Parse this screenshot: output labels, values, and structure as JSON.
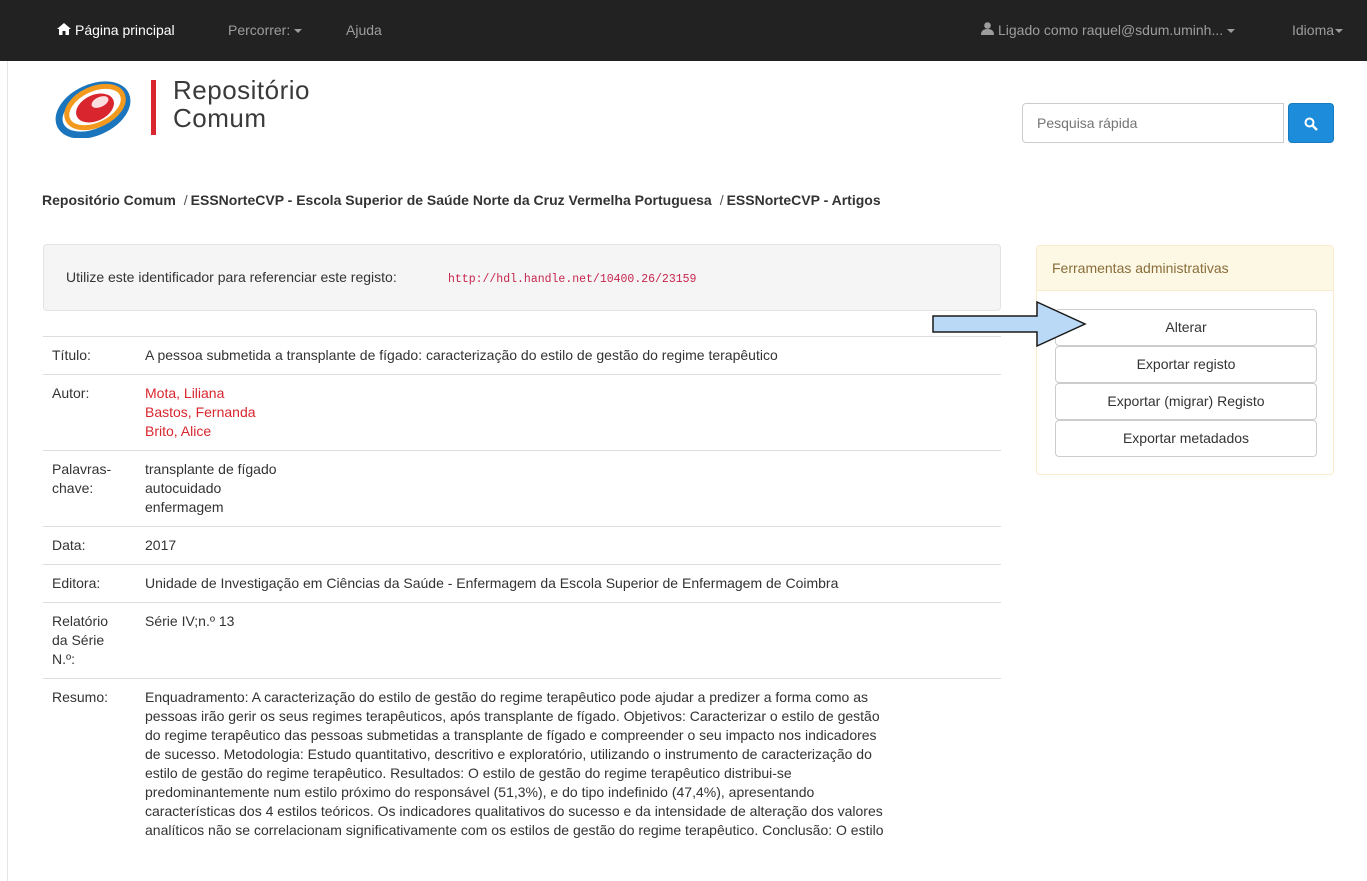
{
  "nav": {
    "home": "Página principal",
    "browse": "Percorrer:",
    "help": "Ajuda",
    "user": "Ligado como raquel@sdum.uminh...",
    "language": "Idioma"
  },
  "logo": {
    "line1": "Repositório",
    "line2": "Comum"
  },
  "search": {
    "placeholder": "Pesquisa rápida"
  },
  "breadcrumb": {
    "items": [
      "Repositório Comum",
      "ESSNorteCVP - Escola Superior de Saúde Norte da Cruz Vermelha Portuguesa",
      "ESSNorteCVP - Artigos"
    ],
    "separator": "/"
  },
  "identifier": {
    "label": "Utilize este identificador para referenciar este registo:",
    "url": "http://hdl.handle.net/10400.26/23159"
  },
  "metadata": {
    "title_label": "Título:",
    "title_value": "A pessoa submetida a transplante de fígado: caracterização do estilo de gestão do regime terapêutico",
    "author_label": "Autor:",
    "authors": [
      "Mota, Liliana",
      "Bastos, Fernanda",
      "Brito, Alice"
    ],
    "keywords_label_1": "Palavras-",
    "keywords_label_2": "chave:",
    "keywords": [
      "transplante de fígado",
      "autocuidado",
      "enfermagem"
    ],
    "date_label": "Data:",
    "date_value": "2017",
    "publisher_label": "Editora:",
    "publisher_value": "Unidade de Investigação em Ciências da Saúde - Enfermagem da Escola Superior de Enfermagem de Coimbra",
    "series_label_1": "Relatório",
    "series_label_2": "da Série",
    "series_label_3": "N.º:",
    "series_value": "Série IV;n.º 13",
    "abstract_label": "Resumo:",
    "abstract_lines": [
      "Enquadramento: A caracterização do estilo de gestão do regime terapêutico pode ajudar a predizer a forma como as",
      "pessoas irão gerir os seus regimes terapêuticos, após transplante de fígado. Objetivos: Caracterizar o estilo de gestão",
      "do regime terapêutico das pessoas submetidas a transplante de fígado e compreender o seu impacto nos indicadores",
      "de sucesso.  Metodologia: Estudo quantitativo, descritivo e exploratório, utilizando o instrumento de caracterização do",
      "estilo de gestão do regime terapêutico. Resultados: O estilo de gestão do regime terapêutico distribui-se",
      "predominantemente num estilo próximo do responsável (51,3%), e do tipo indefinido (47,4%), apresentando",
      "características dos 4 estilos teóricos. Os indicadores qualitativos do sucesso e da intensidade de alteração dos valores",
      "analíticos não se correlacionam significativamente com os estilos de gestão do regime terapêutico. Conclusão: O estilo"
    ]
  },
  "admin": {
    "heading": "Ferramentas administrativas",
    "buttons": [
      "Alterar",
      "Exportar registo",
      "Exportar (migrar) Registo",
      "Exportar metadados"
    ]
  },
  "colors": {
    "navbar": "#222222",
    "accent_red": "#d9262e",
    "search_blue": "#1d8ddb",
    "arrow_fill": "#b9d9f7"
  }
}
